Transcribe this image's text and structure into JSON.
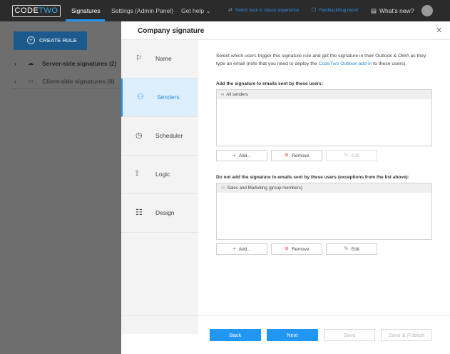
{
  "topbar": {
    "logo_code": "CODE",
    "logo_two": "TWO",
    "nav": [
      "Signatures",
      "Settings (Admin Panel)",
      "Get help ⌄"
    ],
    "switch_link": "Switch back to classic experience",
    "feedback_link": "Feedback/bug report",
    "whats_new": "What's new?"
  },
  "background": {
    "create_rule": "CREATE RULE",
    "tree": [
      "Server-side signatures (2)",
      "Client-side signatures (0)"
    ]
  },
  "modal": {
    "title": "Company signature",
    "steps": [
      "Name",
      "Senders",
      "Scheduler",
      "Logic",
      "Design"
    ],
    "active_step": "Senders",
    "intro_a": "Select which users trigger this signature rule and get the signature in their Outlook & OWA as they type an email (note that you need to deploy the ",
    "intro_link": "CodeTwo Outlook add-in",
    "intro_b": " to these users).",
    "include_label": "Add the signature to emails sent by these users:",
    "include_items": [
      "All senders"
    ],
    "exclude_label": "Do not add the signature to emails sent by these users (exceptions from the list above):",
    "exclude_items": [
      "Sales and Marketing (group members)"
    ],
    "add_label": "Add...",
    "remove_label": "Remove",
    "edit_label": "Edit",
    "footer": {
      "back": "Back",
      "next": "Next",
      "save": "Save",
      "save_publish": "Save & Publish"
    }
  },
  "colors": {
    "accent": "#2196f3",
    "active_step_bg": "#ddeefc",
    "topbar": "#2b2b2b"
  }
}
